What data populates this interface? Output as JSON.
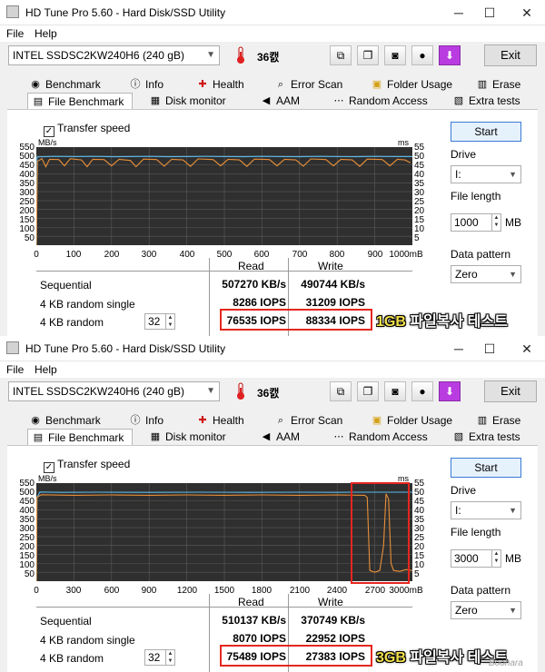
{
  "app": {
    "title": "HD Tune Pro 5.60 - Hard Disk/SSD Utility",
    "menu": [
      "File",
      "Help"
    ],
    "drive": "INTEL SSDSC2KW240H6 (240 gB)",
    "temperature": "36캜",
    "exit_label": "Exit",
    "tabs_row1": [
      "Benchmark",
      "Info",
      "Health",
      "Error Scan",
      "Folder Usage",
      "Erase"
    ],
    "tabs_row2": [
      "File Benchmark",
      "Disk monitor",
      "AAM",
      "Random Access",
      "Extra tests"
    ],
    "active_tab": "File Benchmark",
    "icons": {
      "tabs_row1": [
        "benchmark-icon",
        "info-icon",
        "health-icon",
        "error-scan-icon",
        "folder-usage-icon",
        "erase-icon"
      ],
      "tabs_row2": [
        "file-benchmark-icon",
        "disk-monitor-icon",
        "aam-icon",
        "random-access-icon",
        "extra-tests-icon"
      ],
      "toolbar": [
        "copy-icon",
        "copy-all-icon",
        "camera-icon",
        "coins-icon",
        "download-icon"
      ]
    },
    "colors": {
      "read": "#5bb8e8",
      "write": "#e8903a",
      "chart_bg": "#2f2f2f",
      "highlight": "#e5261f",
      "start_border": "#3a7bd5"
    }
  },
  "labels": {
    "transfer_speed": "Transfer speed",
    "mbs": "MB/s",
    "ms": "ms",
    "read": "Read",
    "write": "Write",
    "sequential": "Sequential",
    "rand_single": "4 KB random single",
    "rand": "4 KB random",
    "start": "Start",
    "drive": "Drive",
    "drive_value": "I:",
    "file_length": "File length",
    "mb": "MB",
    "data_pattern": "Data pattern",
    "pattern_value": "Zero"
  },
  "tests": [
    {
      "file_length": "1000",
      "queue_depth": "32",
      "seq_read": "507270 KB/s",
      "seq_write": "490744 KB/s",
      "single_read": "8286 IOPS",
      "single_write": "31209 IOPS",
      "rand_read": "76535 IOPS",
      "rand_write": "88334 IOPS",
      "caption_num": "1GB",
      "caption_txt": "파일복사 테스트",
      "chart_data": {
        "type": "line",
        "x_ticks": [
          "0",
          "100",
          "200",
          "300",
          "400",
          "500",
          "600",
          "700",
          "800",
          "900",
          "1000mB"
        ],
        "y_ticks_left": [
          "550",
          "500",
          "450",
          "400",
          "350",
          "300",
          "250",
          "200",
          "150",
          "100",
          "50"
        ],
        "y_ticks_right": [
          "55",
          "50",
          "45",
          "40",
          "35",
          "30",
          "25",
          "20",
          "15",
          "10",
          "5"
        ],
        "xlim": [
          0,
          1000
        ],
        "ylim": [
          0,
          550
        ],
        "grid": true,
        "series": [
          {
            "key": "read",
            "values": [
              [
                0,
                0
              ],
              [
                2,
                495
              ],
              [
                50,
                498
              ],
              [
                100,
                497
              ],
              [
                150,
                498
              ],
              [
                200,
                496
              ],
              [
                250,
                497
              ],
              [
                300,
                498
              ],
              [
                350,
                496
              ],
              [
                400,
                497
              ],
              [
                450,
                498
              ],
              [
                500,
                497
              ],
              [
                550,
                496
              ],
              [
                600,
                498
              ],
              [
                650,
                497
              ],
              [
                700,
                496
              ],
              [
                750,
                498
              ],
              [
                800,
                497
              ],
              [
                850,
                496
              ],
              [
                900,
                498
              ],
              [
                950,
                497
              ],
              [
                1000,
                497
              ]
            ]
          },
          {
            "key": "write",
            "values": [
              [
                0,
                0
              ],
              [
                3,
                470
              ],
              [
                15,
                485
              ],
              [
                25,
                440
              ],
              [
                35,
                482
              ],
              [
                60,
                480
              ],
              [
                75,
                445
              ],
              [
                90,
                485
              ],
              [
                120,
                478
              ],
              [
                135,
                440
              ],
              [
                150,
                482
              ],
              [
                180,
                480
              ],
              [
                200,
                445
              ],
              [
                220,
                482
              ],
              [
                250,
                475
              ],
              [
                265,
                440
              ],
              [
                285,
                483
              ],
              [
                320,
                480
              ],
              [
                340,
                443
              ],
              [
                360,
                482
              ],
              [
                390,
                478
              ],
              [
                410,
                442
              ],
              [
                430,
                484
              ],
              [
                470,
                480
              ],
              [
                490,
                445
              ],
              [
                510,
                482
              ],
              [
                540,
                478
              ],
              [
                560,
                442
              ],
              [
                580,
                483
              ],
              [
                620,
                480
              ],
              [
                640,
                445
              ],
              [
                660,
                482
              ],
              [
                690,
                478
              ],
              [
                710,
                443
              ],
              [
                730,
                484
              ],
              [
                770,
                480
              ],
              [
                790,
                445
              ],
              [
                810,
                482
              ],
              [
                840,
                478
              ],
              [
                860,
                442
              ],
              [
                880,
                483
              ],
              [
                920,
                480
              ],
              [
                940,
                445
              ],
              [
                960,
                482
              ],
              [
                980,
                478
              ],
              [
                995,
                462
              ]
            ]
          }
        ]
      }
    },
    {
      "file_length": "3000",
      "queue_depth": "32",
      "seq_read": "510137 KB/s",
      "seq_write": "370749 KB/s",
      "single_read": "8070 IOPS",
      "single_write": "22952 IOPS",
      "rand_read": "75489 IOPS",
      "rand_write": "27383 IOPS",
      "caption_num": "3GB",
      "caption_txt": "파일복사 테스트",
      "chart_data": {
        "type": "line",
        "x_ticks": [
          "0",
          "300",
          "600",
          "900",
          "1200",
          "1500",
          "1800",
          "2100",
          "2400",
          "2700",
          "3000mB"
        ],
        "y_ticks_left": [
          "550",
          "500",
          "450",
          "400",
          "350",
          "300",
          "250",
          "200",
          "150",
          "100",
          "50"
        ],
        "y_ticks_right": [
          "55",
          "50",
          "45",
          "40",
          "35",
          "30",
          "25",
          "20",
          "15",
          "10",
          "5"
        ],
        "xlim": [
          0,
          3000
        ],
        "ylim": [
          0,
          550
        ],
        "grid": true,
        "series": [
          {
            "key": "read",
            "values": [
              [
                0,
                0
              ],
              [
                5,
                470
              ],
              [
                30,
                500
              ],
              [
                200,
                498
              ],
              [
                500,
                499
              ],
              [
                900,
                498
              ],
              [
                1300,
                499
              ],
              [
                1700,
                498
              ],
              [
                2100,
                499
              ],
              [
                2400,
                498
              ],
              [
                2550,
                499
              ],
              [
                3000,
                499
              ]
            ]
          },
          {
            "key": "write",
            "values": [
              [
                0,
                0
              ],
              [
                5,
                470
              ],
              [
                40,
                485
              ],
              [
                300,
                482
              ],
              [
                600,
                484
              ],
              [
                900,
                482
              ],
              [
                1200,
                484
              ],
              [
                1500,
                482
              ],
              [
                1800,
                484
              ],
              [
                2100,
                482
              ],
              [
                2400,
                484
              ],
              [
                2620,
                482
              ],
              [
                2640,
                470
              ],
              [
                2660,
                60
              ],
              [
                2700,
                50
              ],
              [
                2740,
                60
              ],
              [
                2770,
                200
              ],
              [
                2790,
                490
              ],
              [
                2810,
                460
              ],
              [
                2830,
                100
              ],
              [
                2850,
                60
              ],
              [
                2900,
                55
              ],
              [
                2950,
                65
              ],
              [
                3000,
                60
              ]
            ]
          }
        ]
      }
    }
  ],
  "watermark": "Boohara"
}
